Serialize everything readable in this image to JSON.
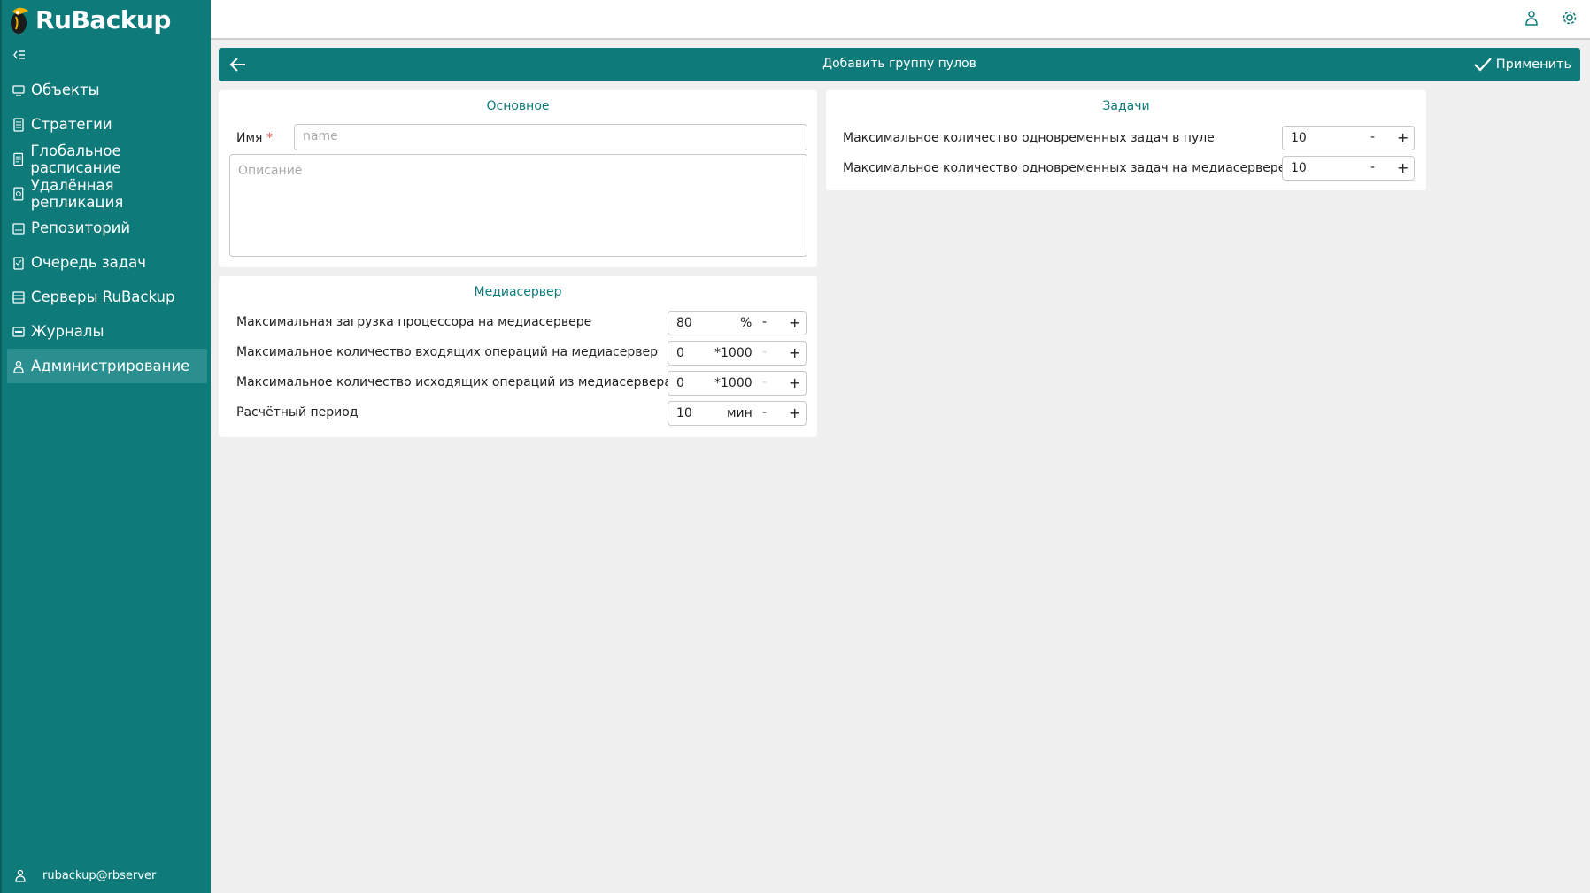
{
  "app": {
    "logo_text": "RuBackup",
    "user": "rubackup@rbserver"
  },
  "sidebar": {
    "items": [
      {
        "label": "Объекты",
        "icon": "monitor-icon"
      },
      {
        "label": "Стратегии",
        "icon": "document-icon"
      },
      {
        "label": "Глобальное расписание",
        "icon": "list-document-icon"
      },
      {
        "label": "Удалённая репликация",
        "icon": "replication-icon"
      },
      {
        "label": "Репозиторий",
        "icon": "repository-icon"
      },
      {
        "label": "Очередь задач",
        "icon": "task-queue-icon"
      },
      {
        "label": "Серверы RuBackup",
        "icon": "servers-icon"
      },
      {
        "label": "Журналы",
        "icon": "log-icon"
      },
      {
        "label": "Администрирование",
        "icon": "admin-icon",
        "active": true
      }
    ]
  },
  "header": {
    "title": "Добавить группу пулов",
    "apply_label": "Применить"
  },
  "basic": {
    "title": "Основное",
    "name_label": "Имя",
    "required_mark": "*",
    "name_placeholder": "name",
    "description_placeholder": "Описание"
  },
  "mediaserver": {
    "title": "Медиасервер",
    "rows": [
      {
        "label": "Максимальная загрузка процессора на медиасервере",
        "value": "80",
        "unit": "%"
      },
      {
        "label": "Максимальное количество входящих операций на медиасервер",
        "value": "0",
        "unit": "*1000"
      },
      {
        "label": "Максимальное количество исходящих операций из медиасервера",
        "value": "0",
        "unit": "*1000"
      },
      {
        "label": "Расчётный период",
        "value": "10",
        "unit": "мин"
      }
    ]
  },
  "tasks": {
    "title": "Задачи",
    "rows": [
      {
        "label": "Максимальное количество одновременных задач в пуле",
        "value": "10"
      },
      {
        "label": "Максимальное количество одновременных задач на медиасервере",
        "value": "10"
      }
    ]
  },
  "controls": {
    "minus": "-",
    "plus": "+"
  },
  "colors": {
    "accent": "#0e7a7a",
    "active_item": "#2b8f8f",
    "required": "#e04848"
  }
}
